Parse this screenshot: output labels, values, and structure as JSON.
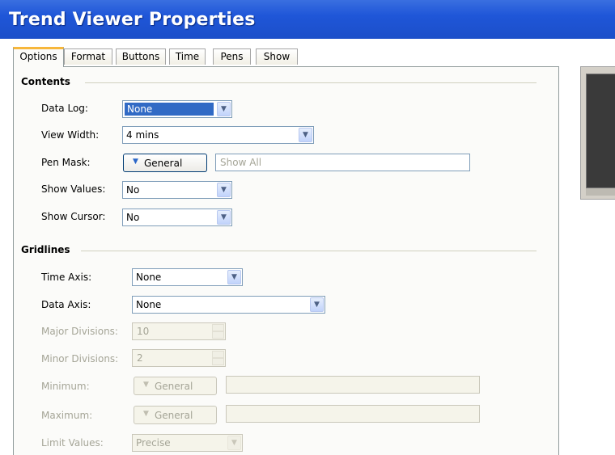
{
  "window": {
    "title": "Trend Viewer Properties"
  },
  "tabs": [
    "Options",
    "Format",
    "Buttons",
    "Time",
    "Pens",
    "Show"
  ],
  "contents": {
    "section_title": "Contents",
    "data_log": {
      "label": "Data Log:",
      "value": "None"
    },
    "view_width": {
      "label": "View Width:",
      "value": "4 mins"
    },
    "pen_mask": {
      "label": "Pen Mask:",
      "button": "General",
      "placeholder": "Show All"
    },
    "show_values": {
      "label": "Show Values:",
      "value": "No"
    },
    "show_cursor": {
      "label": "Show Cursor:",
      "value": "No"
    }
  },
  "gridlines": {
    "section_title": "Gridlines",
    "time_axis": {
      "label": "Time Axis:",
      "value": "None"
    },
    "data_axis": {
      "label": "Data Axis:",
      "value": "None"
    },
    "major_divisions": {
      "label": "Major Divisions:",
      "value": "10"
    },
    "minor_divisions": {
      "label": "Minor Divisions:",
      "value": "2"
    },
    "minimum": {
      "label": "Minimum:",
      "button": "General"
    },
    "maximum": {
      "label": "Maximum:",
      "button": "General"
    },
    "limit_values": {
      "label": "Limit Values:",
      "value": "Precise"
    }
  },
  "colors": {
    "titlebar": "#1f56d8",
    "selection": "#316ac5",
    "active_tab_accent": "#f7b73c",
    "disabled_text": "#a5a597"
  },
  "icons": {
    "combo_arrow": "chevron-down-icon",
    "menu_arrow": "triangle-down-icon"
  }
}
